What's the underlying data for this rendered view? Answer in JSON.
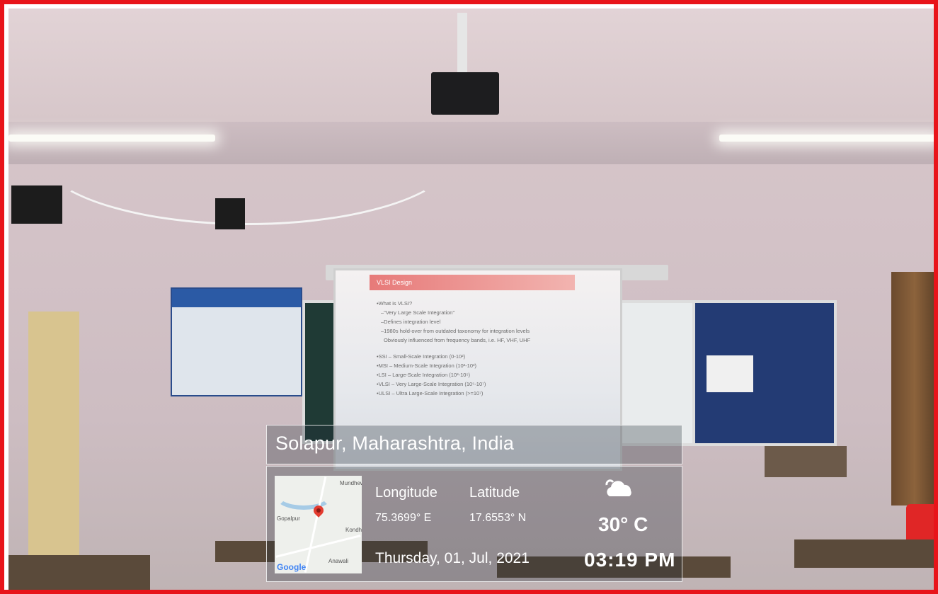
{
  "location": {
    "title": "Solapur, Maharashtra, India"
  },
  "coords": {
    "longitude_label": "Longitude",
    "latitude_label": "Latitude",
    "longitude_value": "75.3699° E",
    "latitude_value": "17.6553° N"
  },
  "weather": {
    "temperature": "30° C",
    "icon": "cloud-icon"
  },
  "datetime": {
    "date": "Thursday, 01, Jul, 2021",
    "time": "03:19 PM"
  },
  "map": {
    "labels": [
      "Mundhewa",
      "Gopalpur",
      "Kondha",
      "Anawali"
    ],
    "brand": "Google"
  },
  "slide": {
    "title": "VLSI Design",
    "lines": [
      "•What is VLSI?",
      "–\"Very Large Scale Integration\"",
      "–Defines integration level",
      "–1980s hold-over from outdated taxonomy for integration levels",
      "Obviously influenced from frequency bands, i.e. HF, VHF, UHF",
      "",
      "•SSI – Small-Scale Integration (0-10²)",
      "•MSI – Medium-Scale Integration (10²-10³)",
      "•LSI – Large-Scale Integration (10³-10⁵)",
      "•VLSI – Very Large-Scale Integration (10⁵-10⁷)",
      "•ULSI – Ultra Large-Scale Integration (>=10⁷)"
    ]
  },
  "colors": {
    "border": "#e8141a",
    "overlay_text": "#ffffff"
  }
}
